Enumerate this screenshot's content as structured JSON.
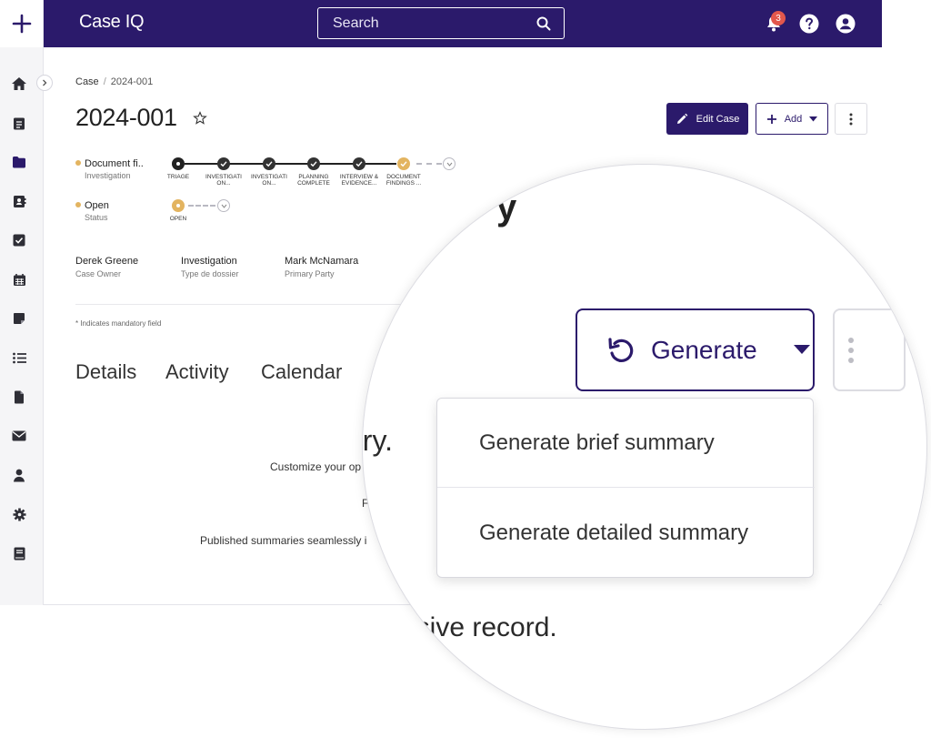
{
  "topbar": {
    "brand": "Case IQ",
    "search_placeholder": "Search",
    "notification_count": "3"
  },
  "breadcrumb": {
    "root": "Case",
    "current": "2024-001"
  },
  "case": {
    "title": "2024-001",
    "edit_label": "Edit Case",
    "add_label": "Add"
  },
  "workflow": {
    "label": "Document fi..",
    "sub": "Investigation",
    "stages": [
      "TRIAGE",
      "INVESTIGATI ON...",
      "INVESTIGATI ON...",
      "PLANNING COMPLETE",
      "INTERVIEW & EVIDENCE...",
      "DOCUMENT FINDINGS ..."
    ]
  },
  "status": {
    "label": "Open",
    "sub": "Status",
    "stage": "OPEN"
  },
  "people": [
    {
      "name": "Derek Greene",
      "role": "Case Owner"
    },
    {
      "name": "Investigation",
      "role": "Type de dossier"
    },
    {
      "name": "Mark McNamara",
      "role": "Primary Party"
    }
  ],
  "mandatory_note": "* Indicates mandatory field",
  "tabs": [
    "Details",
    "Activity",
    "Calendar"
  ],
  "summary_text": {
    "line1": "ary.",
    "line2": "Customize your op",
    "line3": "F",
    "line4": "Published summaries seamlessly i",
    "line5": "esive record."
  },
  "magnified": {
    "heading_fragment": "y",
    "generate_label": "Generate",
    "menu_items": [
      "Generate brief summary",
      "Generate detailed summary"
    ]
  },
  "colors": {
    "brand": "#2b1a6b",
    "accent": "#e3b460",
    "badge": "#e2574c"
  }
}
